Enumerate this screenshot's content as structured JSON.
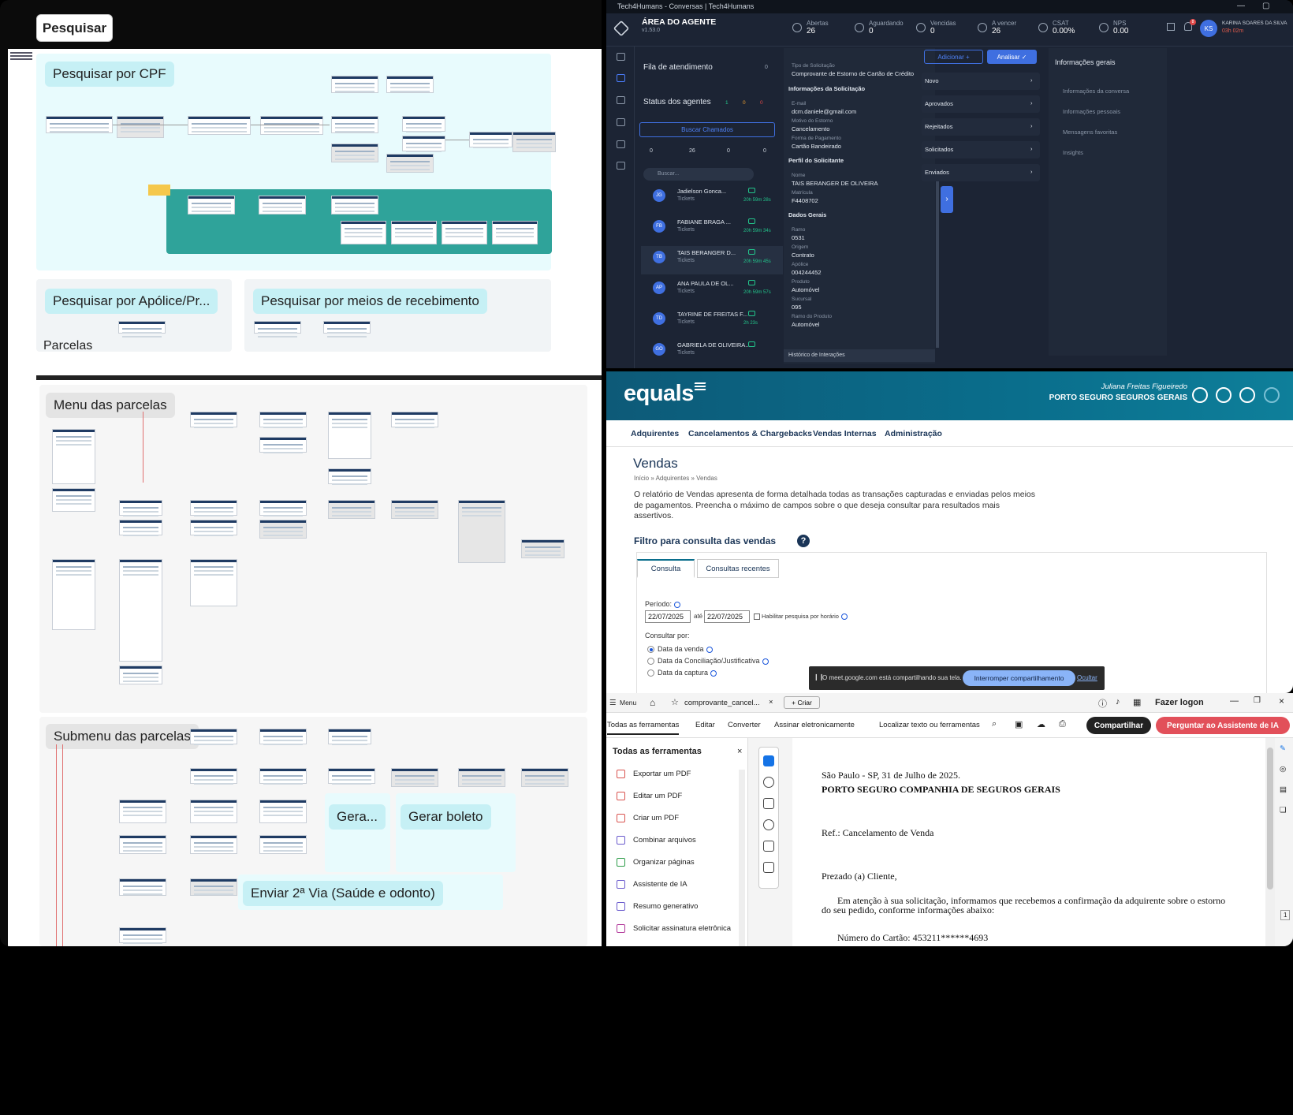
{
  "whiteboard": {
    "search_button": "Pesquisar",
    "sections": {
      "cpf": "Pesquisar por CPF",
      "apolice": "Pesquisar por Apólice/Pr...",
      "meios": "Pesquisar por meios de recebimento",
      "parcelas": "Parcelas",
      "menu_parcelas": "Menu das parcelas",
      "submenu_parcelas": "Submenu das parcelas",
      "gera": "Gera...",
      "gerar_boleto": "Gerar boleto",
      "enviar_2via": "Enviar 2ª Via (Saúde e odonto)"
    }
  },
  "t4h": {
    "window_title": "Tech4Humans - Conversas | Tech4Humans",
    "app_title": "ÁREA DO AGENTE",
    "version": "v1.53.0",
    "stats": [
      {
        "label": "Abertas",
        "value": "26"
      },
      {
        "label": "Aguardando",
        "value": "0"
      },
      {
        "label": "Vencidas",
        "value": "0"
      },
      {
        "label": "A vencer",
        "value": "26"
      },
      {
        "label": "CSAT",
        "value": "0.00%"
      },
      {
        "label": "NPS",
        "value": "0.00"
      }
    ],
    "notif_count": "8",
    "user_initials": "KS",
    "user_name": "KARINA SOARES DA SILVA",
    "user_time": "03h 02m",
    "queue_title": "Fila de atendimento",
    "queue_count": "0",
    "status_title": "Status dos agentes",
    "status_counts": [
      "1",
      "0",
      "0"
    ],
    "buscar_chamados": "Buscar Chamados",
    "mini_counts": [
      "0",
      "26",
      "0",
      "0"
    ],
    "search_placeholder": "Buscar...",
    "conversations": [
      {
        "initials": "JG",
        "name": "Jadielson Gonca...",
        "type": "Tickets",
        "time": "20h 59m 28s"
      },
      {
        "initials": "FB",
        "name": "FABIANE BRAGA ...",
        "type": "Tickets",
        "time": "20h 59m 34s"
      },
      {
        "initials": "TB",
        "name": "TAIS BERANGER D...",
        "type": "Tickets",
        "time": "20h 59m 45s"
      },
      {
        "initials": "AP",
        "name": "ANA PAULA DE OL...",
        "type": "Tickets",
        "time": "20h 59m 57s"
      },
      {
        "initials": "TD",
        "name": "TAYRINE DE FREITAS F...",
        "type": "Tickets",
        "time": "2h 23s"
      },
      {
        "initials": "GO",
        "name": "GABRIELA DE OLIVEIRA...",
        "type": "Tickets",
        "time": ""
      }
    ],
    "details": {
      "tipo_label": "Tipo de Solicitação",
      "tipo_value": "Comprovante de Estorno de Cartão de Crédito",
      "info_head": "Informações da Solicitação",
      "email_label": "E-mail",
      "email_value": "dcm.daniele@gmail.com",
      "motivo_label": "Motivo do Estorno",
      "motivo_value": "Cancelamento",
      "forma_label": "Forma de Pagamento",
      "forma_value": "Cartão Bandeirado",
      "perfil_head": "Perfil do Solicitante",
      "nome_label": "Nome",
      "nome_value": "TAIS BERANGER DE OLIVEIRA",
      "matricula_label": "Matrícula",
      "matricula_value": "F4408702",
      "dados_head": "Dados Gerais",
      "ramo_label": "Ramo",
      "ramo_value": "0531",
      "origem_label": "Origem",
      "origem_value": "Contrato",
      "apolice_label": "Apólice",
      "apolice_value": "004244452",
      "produto_label": "Produto",
      "produto_value": "Automóvel",
      "sucursal_label": "Sucursal",
      "sucursal_value": "095",
      "ramo_prod_label": "Ramo do Produto",
      "ramo_prod_value": "Automóvel",
      "historico": "Histórico de Interações"
    },
    "adicionar": "Adicionar +",
    "analisar": "Analisar ✓",
    "categories": [
      "Novo",
      "Aprovados",
      "Rejeitados",
      "Solicitados",
      "Enviados"
    ],
    "info_title": "Informações gerais",
    "info_items": [
      "Informações da conversa",
      "Informações pessoais",
      "Mensagens favoritas",
      "Insights"
    ]
  },
  "equals": {
    "logo": "equals",
    "user_name": "Juliana Freitas Figueiredo",
    "company": "PORTO SEGURO SEGUROS GERAIS",
    "nav": [
      "Adquirentes",
      "Cancelamentos & Chargebacks",
      "Vendas Internas",
      "Administração"
    ],
    "title": "Vendas",
    "breadcrumb": "Início » Adquirentes » Vendas",
    "description": "O relatório de Vendas apresenta de forma detalhada todas as transações capturadas e enviadas pelos meios de pagamentos. Preencha o máximo de campos sobre o que deseja consultar para resultados mais assertivos.",
    "filter_title": "Filtro para consulta das vendas",
    "tabs": [
      "Consulta",
      "Consultas recentes"
    ],
    "periodo_label": "Período:",
    "date_from": "22/07/2025",
    "ate": "até",
    "date_to": "22/07/2025",
    "habilitar": "Habilitar pesquisa por horário",
    "consultar_por": "Consultar por:",
    "radios": [
      "Data da venda",
      "Data da Conciliação/Justificativa",
      "Data da captura"
    ],
    "share_text": "O meet.google.com está compartilhando sua tela.",
    "share_stop": "Interromper compartilhamento",
    "share_hide": "Ocultar"
  },
  "acrobat": {
    "menu": "Menu",
    "tab_title": "comprovante_cancel...",
    "create": "+ Criar",
    "login": "Fazer logon",
    "toolbar": [
      "Todas as ferramentas",
      "Editar",
      "Converter",
      "Assinar eletronicamente"
    ],
    "find": "Localizar texto ou ferramentas",
    "share": "Compartilhar",
    "ai": "Perguntar ao Assistente de IA",
    "tools_title": "Todas as ferramentas",
    "tools": [
      "Exportar um PDF",
      "Editar um PDF",
      "Criar um PDF",
      "Combinar arquivos",
      "Organizar páginas",
      "Assistente de IA",
      "Resumo generativo",
      "Solicitar assinatura eletrônica"
    ],
    "page_lines": [
      "São Paulo - SP, 31 de Julho de 2025.",
      "PORTO SEGURO COMPANHIA DE SEGUROS GERAIS",
      "Ref.: Cancelamento de Venda",
      "Prezado (a) Cliente,",
      "Em atenção à sua solicitação, informamos que recebemos a confirmação da adquirente sobre o estorno",
      "do seu pedido, conforme informações abaixo:",
      "Número do Cartão: 453211******4693"
    ],
    "page_num": "1"
  }
}
